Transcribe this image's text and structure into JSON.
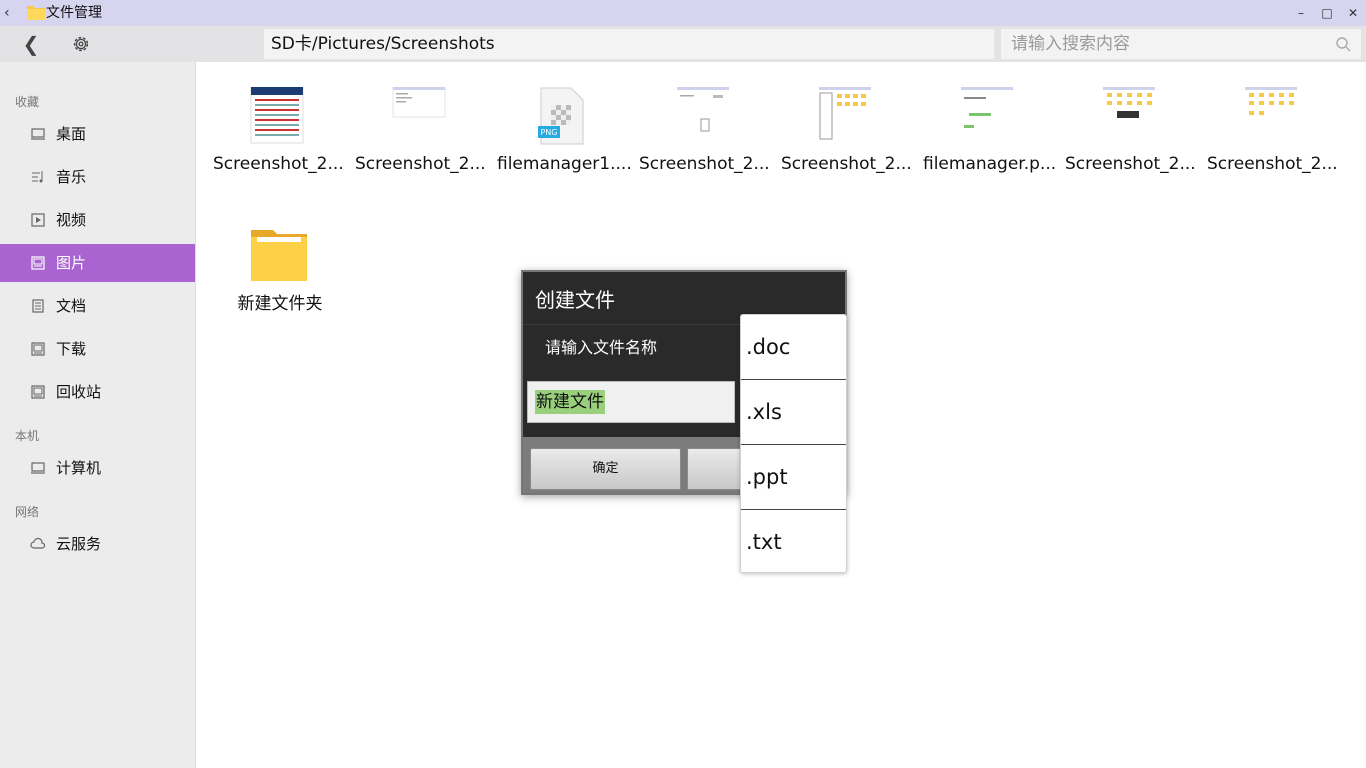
{
  "window": {
    "title": "文件管理",
    "controls": {
      "minimize": "–",
      "maximize": "□",
      "close": "✕"
    }
  },
  "toolbar": {
    "path": "SD卡/Pictures/Screenshots",
    "search_placeholder": "请输入搜索内容"
  },
  "sidebar": {
    "sections": [
      {
        "title": "收藏",
        "items": [
          {
            "label": "桌面",
            "icon": "monitor-icon"
          },
          {
            "label": "音乐",
            "icon": "music-icon"
          },
          {
            "label": "视频",
            "icon": "video-icon"
          },
          {
            "label": "图片",
            "icon": "picture-icon",
            "active": true
          },
          {
            "label": "文档",
            "icon": "document-icon"
          },
          {
            "label": "下载",
            "icon": "download-icon"
          },
          {
            "label": "回收站",
            "icon": "recycle-icon"
          }
        ]
      },
      {
        "title": "本机",
        "items": [
          {
            "label": "计算机",
            "icon": "computer-icon"
          }
        ]
      },
      {
        "title": "网络",
        "items": [
          {
            "label": "云服务",
            "icon": "cloud-icon"
          }
        ]
      }
    ]
  },
  "files": [
    {
      "name": "Screenshot_2...",
      "thumb": "screenshot-thumbnail"
    },
    {
      "name": "Screenshot_2...",
      "thumb": "screenshot-thumbnail"
    },
    {
      "name": "filemanager1....",
      "thumb": "png-file-icon",
      "badge": "PNG"
    },
    {
      "name": "Screenshot_2...",
      "thumb": "screenshot-thumbnail"
    },
    {
      "name": "Screenshot_2...",
      "thumb": "screenshot-thumbnail"
    },
    {
      "name": "filemanager.p...",
      "thumb": "screenshot-thumbnail"
    },
    {
      "name": "Screenshot_2...",
      "thumb": "screenshot-thumbnail"
    },
    {
      "name": "Screenshot_2...",
      "thumb": "screenshot-thumbnail"
    },
    {
      "name": "新建文件夹",
      "thumb": "folder-icon"
    }
  ],
  "dialog": {
    "title": "创建文件",
    "message": "请输入文件名称",
    "input_value": "新建文件",
    "confirm_label": "确定",
    "cancel_label": ""
  },
  "extension_menu": {
    "options": [
      ".doc",
      ".xls",
      ".ppt",
      ".txt"
    ]
  },
  "colors": {
    "titlebar": "#d6d4ee",
    "sidebar_active": "#a964d2",
    "folder": "#f7c948",
    "dialog_bg": "#2a2a2a",
    "selection": "#9ad07c"
  }
}
